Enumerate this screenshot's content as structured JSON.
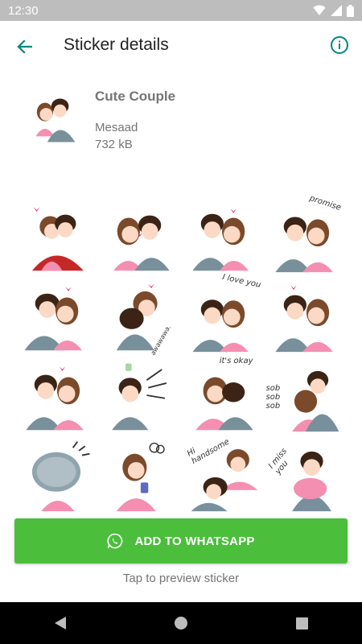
{
  "status_bar": {
    "time": "12:30",
    "icons": [
      "wifi-icon",
      "signal-icon",
      "battery-icon"
    ]
  },
  "app_bar": {
    "title": "Sticker details",
    "back_icon": "arrow-back-icon",
    "info_icon": "info-icon",
    "accent_color": "#00897b"
  },
  "pack": {
    "name": "Cute Couple",
    "publisher": "Mesaad",
    "size": "732 kB",
    "tray_icon": "couple-tray-icon"
  },
  "stickers": [
    {
      "caption": ""
    },
    {
      "caption": ""
    },
    {
      "caption": ""
    },
    {
      "caption": "promise"
    },
    {
      "caption": ""
    },
    {
      "caption": "awawawa."
    },
    {
      "caption": "I love you"
    },
    {
      "caption": ""
    },
    {
      "caption": ""
    },
    {
      "caption": ""
    },
    {
      "caption": "it's okay"
    },
    {
      "caption": "sob sob sob"
    },
    {
      "caption": ""
    },
    {
      "caption": ""
    },
    {
      "caption": "Hi handsome"
    },
    {
      "caption": "I miss you"
    }
  ],
  "actions": {
    "add_button_label": "ADD TO WHATSAPP",
    "add_button_color": "#4bbe3c",
    "hint": "Tap to preview sticker"
  },
  "nav": {
    "back": "nav-back-icon",
    "home": "nav-home-icon",
    "recents": "nav-recents-icon"
  }
}
